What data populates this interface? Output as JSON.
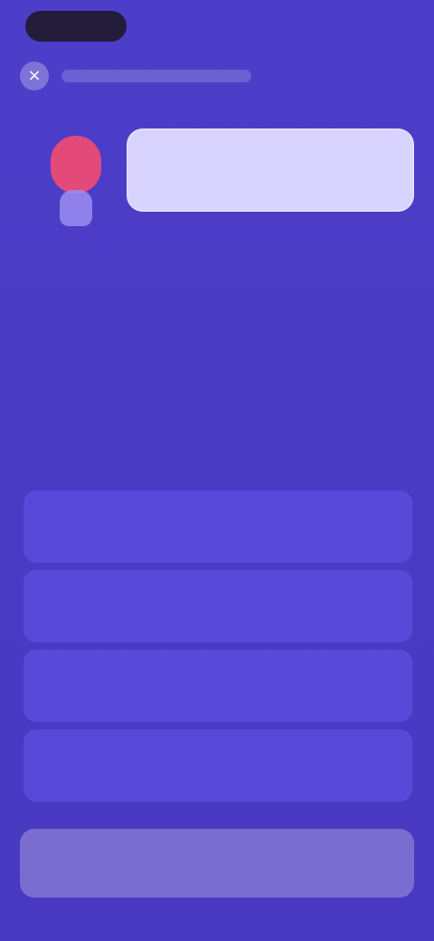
{
  "status_bar": {
    "time": ""
  },
  "top_bar": {
    "close_icon": "close-icon",
    "progress_percent": 0
  },
  "prompt": {
    "bubble_text": "",
    "instruction": ""
  },
  "options": [
    {
      "label": ""
    },
    {
      "label": ""
    },
    {
      "label": ""
    },
    {
      "label": ""
    }
  ],
  "bottom": {
    "check_label": ""
  },
  "colors": {
    "background": "#4b3cc6",
    "progress": "#3fbf88",
    "bubble": "#d9d3ff",
    "option": "#5a49d9",
    "button": "#7b6ccf",
    "character": "#e34a79"
  }
}
